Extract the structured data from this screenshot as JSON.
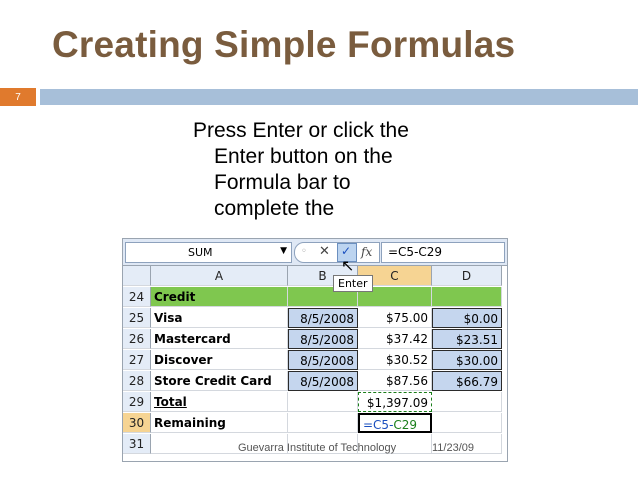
{
  "slide": {
    "title": "Creating Simple Formulas",
    "number": "7",
    "bullet_line1": "Press Enter or click the",
    "bullet_line2": "Enter button on the",
    "bullet_line3": "Formula bar to",
    "bullet_line4": "complete the",
    "footer_text": "Guevarra Institute of Technology",
    "footer_date": "11/23/09",
    "colors": {
      "title": "#7a5c3e",
      "accent_orange": "#e07a2d",
      "rule_blue": "#a7bfd9"
    }
  },
  "excel": {
    "name_box": "SUM",
    "formula": "=C5-C29",
    "tooltip": "Enter",
    "buttons": {
      "cancel": "✕",
      "enter": "✓",
      "fx": "fx"
    },
    "columns": [
      "A",
      "B",
      "C",
      "D"
    ],
    "rows": [
      {
        "num": "24",
        "a": "Credit",
        "b": "",
        "c": "",
        "d": ""
      },
      {
        "num": "25",
        "a": "Visa",
        "b": "8/5/2008",
        "c": "$75.00",
        "d": "$0.00"
      },
      {
        "num": "26",
        "a": "Mastercard",
        "b": "8/5/2008",
        "c": "$37.42",
        "d": "$23.51"
      },
      {
        "num": "27",
        "a": "Discover",
        "b": "8/5/2008",
        "c": "$30.52",
        "d": "$30.00"
      },
      {
        "num": "28",
        "a": "Store Credit Card",
        "b": "8/5/2008",
        "c": "$87.56",
        "d": "$66.79"
      },
      {
        "num": "29",
        "a": "Total",
        "b": "",
        "c": "$1,397.09",
        "d": ""
      },
      {
        "num": "30",
        "a": "Remaining",
        "b": "",
        "c_part1": "=C5-",
        "c_part2": "C29",
        "d": ""
      },
      {
        "num": "31",
        "a": "",
        "b": "",
        "c": "",
        "d": ""
      }
    ]
  }
}
